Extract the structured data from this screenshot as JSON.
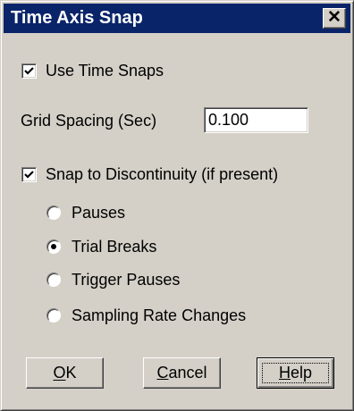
{
  "window": {
    "title": "Time Axis Snap",
    "close_label": "✕"
  },
  "use_time_snaps": {
    "label": "Use Time Snaps",
    "checked": true
  },
  "grid_spacing": {
    "label": "Grid Spacing (Sec)",
    "value": "0.100"
  },
  "snap_discontinuity": {
    "label": "Snap to Discontinuity (if present)",
    "checked": true
  },
  "radio_options": [
    {
      "label": "Pauses",
      "selected": false
    },
    {
      "label": "Trial Breaks",
      "selected": true
    },
    {
      "label": "Trigger Pauses",
      "selected": false
    },
    {
      "label": "Sampling Rate Changes",
      "selected": false
    }
  ],
  "buttons": {
    "ok": "OK",
    "cancel": "Cancel",
    "help": "Help"
  },
  "colors": {
    "titlebar": "#0a246a",
    "face": "#d4d0c8"
  }
}
